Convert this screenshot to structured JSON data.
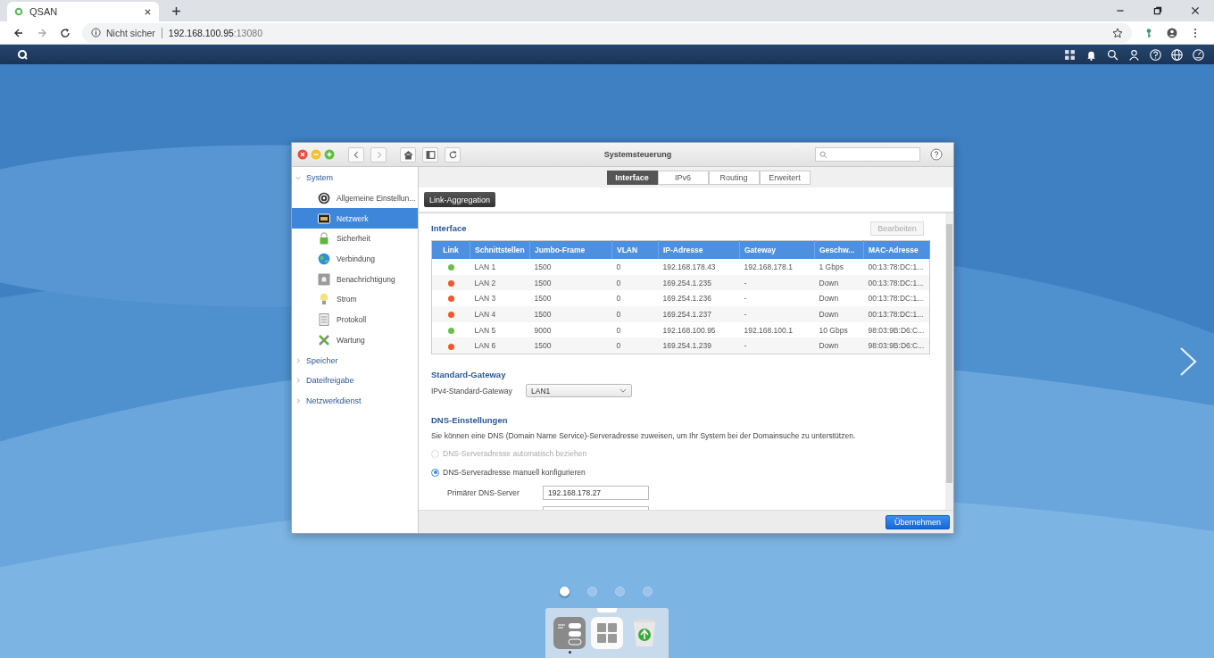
{
  "browser": {
    "tab_title": "QSAN",
    "security_label": "Nicht sicher",
    "url_host": "192.168.100.95",
    "url_port": ":13080"
  },
  "window": {
    "title": "Systemsteuerung"
  },
  "sidebar": {
    "groups": [
      {
        "label": "System",
        "expanded": true,
        "children": [
          {
            "label": "Allgemeine Einstellun...",
            "selected": false
          },
          {
            "label": "Netzwerk",
            "selected": true
          },
          {
            "label": "Sicherheit",
            "selected": false
          },
          {
            "label": "Verbindung",
            "selected": false
          },
          {
            "label": "Benachrichtigung",
            "selected": false
          },
          {
            "label": "Strom",
            "selected": false
          },
          {
            "label": "Protokoll",
            "selected": false
          },
          {
            "label": "Wartung",
            "selected": false
          }
        ]
      },
      {
        "label": "Speicher",
        "expanded": false
      },
      {
        "label": "Dateifreigabe",
        "expanded": false
      },
      {
        "label": "Netzwerkdienst",
        "expanded": false
      }
    ]
  },
  "tabs": [
    {
      "label": "Interface",
      "selected": true
    },
    {
      "label": "IPv6",
      "selected": false
    },
    {
      "label": "Routing",
      "selected": false
    },
    {
      "label": "Erweitert",
      "selected": false
    }
  ],
  "toolbar_button": "Link-Aggregation",
  "interface": {
    "title": "Interface",
    "edit_button": {
      "label": "Bearbeiten",
      "disabled": true
    },
    "columns": [
      "Link",
      "Schnittstellen",
      "Jumbo-Frame",
      "VLAN",
      "IP-Adresse",
      "Gateway",
      "Geschw...",
      "MAC-Adresse"
    ],
    "rows": [
      {
        "color": "#6cbf4a",
        "cells": [
          "",
          "LAN 1",
          "1500",
          "0",
          "192.168.178.43",
          "192.168.178.1",
          "1 Gbps",
          "00:13:78:DC:1..."
        ]
      },
      {
        "color": "#f0582a",
        "cells": [
          "",
          "LAN 2",
          "1500",
          "0",
          "169.254.1.235",
          "-",
          "Down",
          "00:13:78:DC:1..."
        ]
      },
      {
        "color": "#f0582a",
        "cells": [
          "",
          "LAN 3",
          "1500",
          "0",
          "169.254.1.236",
          "-",
          "Down",
          "00:13:78:DC:1..."
        ]
      },
      {
        "color": "#f0582a",
        "cells": [
          "",
          "LAN 4",
          "1500",
          "0",
          "169.254.1.237",
          "-",
          "Down",
          "00:13:78:DC:1..."
        ]
      },
      {
        "color": "#6cbf4a",
        "cells": [
          "",
          "LAN 5",
          "9000",
          "0",
          "192.168.100.95",
          "192.168.100.1",
          "10 Gbps",
          "98:03:9B:D6:C..."
        ]
      },
      {
        "color": "#f0582a",
        "cells": [
          "",
          "LAN 6",
          "1500",
          "0",
          "169.254.1.239",
          "-",
          "Down",
          "98:03:9B:D6:C..."
        ]
      }
    ]
  },
  "gateway": {
    "title": "Standard-Gateway",
    "label": "IPv4-Standard-Gateway",
    "value": "LAN1"
  },
  "dns": {
    "title": "DNS-Einstellungen",
    "description": "Sie können eine DNS (Domain Name Service)-Serveradresse zuweisen, um Ihr System bei der Domainsuche zu unterstützen.",
    "options": [
      {
        "label": "DNS-Serveradresse automatisch beziehen",
        "selected": false,
        "disabled": true
      },
      {
        "label": "DNS-Serveradresse manuell konfigurieren",
        "selected": true,
        "disabled": false
      }
    ],
    "fields": [
      {
        "label": "Primärer DNS-Server",
        "value": "192.168.178.27"
      }
    ]
  },
  "apply_button": "Übernehmen",
  "pager": [
    {
      "selected": true
    },
    {
      "selected": false
    },
    {
      "selected": false
    },
    {
      "selected": false
    }
  ],
  "dock": [
    {
      "kind": "control-panel",
      "running": true
    },
    {
      "kind": "apps",
      "running": false
    },
    {
      "kind": "recycle-bin",
      "running": false
    }
  ]
}
